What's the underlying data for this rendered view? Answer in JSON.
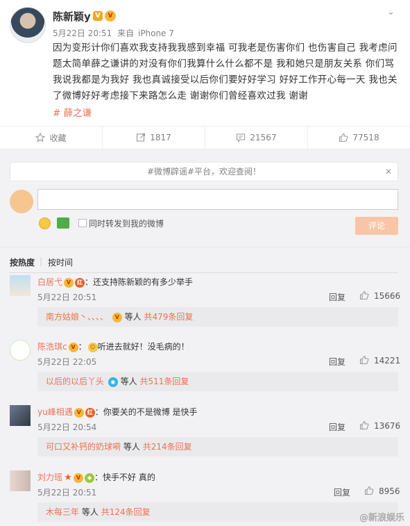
{
  "post": {
    "username": "陈新颖y",
    "vip_badge": "V",
    "date": "5月22日 20:51",
    "source_prefix": "来自",
    "device": "iPhone 7",
    "content": "因为变形计你们喜欢我支持我我感到幸福 可我老是伤害你们 也伤害自己 我考虑问题太简单薛之谦讲的对没有你们我算什么什么都不是 我和她只是朋友关系 你们骂我说我都是为我好 我也真诚接受以后你们要好好学习 好好工作开心每一天 我也关了微博好好考虑接下来路怎么走 谢谢你们曾经喜欢过我 谢谢",
    "topic": "# 薛之谦"
  },
  "actions": {
    "favorite": "收藏",
    "repost": "1817",
    "comment": "21567",
    "like": "77518"
  },
  "comment_box": {
    "notice": "#微博辟谣#平台，欢迎查阅！",
    "repost_label": "同时转发到我的微博",
    "submit": "评论"
  },
  "sort": {
    "hot": "按热度",
    "sep": "|",
    "time": "按时间"
  },
  "comments": [
    {
      "name": "白居弋",
      "text": "：还支持陈新颖的有多少举手",
      "time": "5月22日 20:51",
      "reply": "回复",
      "likes": "15666",
      "sub_user": "南方姑娘丶、、、、",
      "sub_mid": "等人",
      "sub_count": "共479条回复"
    },
    {
      "name": "陈浩琪c",
      "text": "听进去就好！没毛病的！",
      "time": "5月22日 22:05",
      "reply": "回复",
      "likes": "14221",
      "sub_user": "以后的以后丫头",
      "sub_mid": "等人",
      "sub_count": "共511条回复"
    },
    {
      "name": "yu峰相遇",
      "text": "：你要关的不是微博 是快手",
      "time": "5月22日 20:54",
      "reply": "回复",
      "likes": "13676",
      "sub_user": "可口又补钙的奶球嗬",
      "sub_mid": "等人",
      "sub_count": "共214条回复"
    },
    {
      "name": "刘力瑶",
      "text": "：快手不好 真的",
      "time": "5月22日 20:51",
      "reply": "回复",
      "likes": "8956",
      "sub_user": "木每三年",
      "sub_mid": "等人",
      "sub_count": "共124条回复"
    }
  ],
  "watermark": "@新浪娱乐",
  "colors": {
    "accent": "#eb7350",
    "background": "#f2f2f5",
    "submit": "#f9c5a8"
  }
}
